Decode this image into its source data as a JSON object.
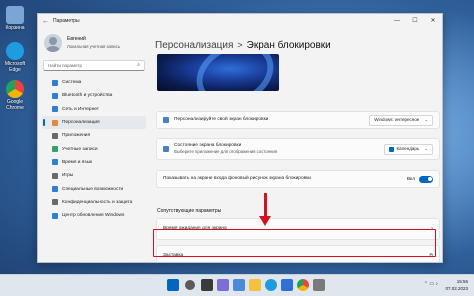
{
  "desktop": {
    "icons": [
      {
        "label": "Корзина",
        "color": "#7aa6d6"
      },
      {
        "label": "Microsoft Edge",
        "color": "#1f9ce0"
      },
      {
        "label": "Google Chrome",
        "color": "#e8453c"
      }
    ]
  },
  "window": {
    "title": "Параметры",
    "controls": [
      "—",
      "☐",
      "✕"
    ]
  },
  "profile": {
    "name": "Евгений",
    "subtitle": "Локальная учетная запись"
  },
  "search": {
    "placeholder": "Найти параметр",
    "icon": "search-icon"
  },
  "nav": {
    "items": [
      {
        "label": "Система",
        "icon_color": "#2f7fd6"
      },
      {
        "label": "Bluetooth и устройства",
        "icon_color": "#2f7fd6"
      },
      {
        "label": "Сеть и Интернет",
        "icon_color": "#2f7fd6"
      },
      {
        "label": "Персонализация",
        "icon_color": "#e08a3a"
      },
      {
        "label": "Приложения",
        "icon_color": "#6a6a6a"
      },
      {
        "label": "Учетные записи",
        "icon_color": "#2fa36b"
      },
      {
        "label": "Время и язык",
        "icon_color": "#2f7fd6"
      },
      {
        "label": "Игры",
        "icon_color": "#6a6a6a"
      },
      {
        "label": "Специальные возможности",
        "icon_color": "#2f7fd6"
      },
      {
        "label": "Конфиденциальность и защита",
        "icon_color": "#6a6a6a"
      },
      {
        "label": "Центр обновления Windows",
        "icon_color": "#2f7fd6"
      }
    ],
    "active_index": 3
  },
  "breadcrumb": {
    "parent": "Персонализация",
    "separator": ">",
    "current": "Экран блокировки"
  },
  "settings": {
    "personalize_label": "Персонализируйте свой экран блокировки",
    "personalize_value": "Windows: интересное",
    "status_label": "Состояние экрана блокировки",
    "status_sub": "Выберите приложение для отображения состояния",
    "status_value": "Календарь",
    "signin_bg_label": "Показывать на экране входа фоновый рисунок экрана блокировки",
    "signin_bg_value": "Вкл",
    "signin_bg_on": true
  },
  "related": {
    "title": "Сопутствующие параметры",
    "timeout_label": "Время ожидания для экрана",
    "screensaver_label": "Заставка"
  },
  "taskbar": {
    "time": "15:56",
    "date": "07.02.2023",
    "accent": "#0067c0"
  },
  "colors": {
    "accent": "#0067c0",
    "highlight": "#d3121f"
  }
}
